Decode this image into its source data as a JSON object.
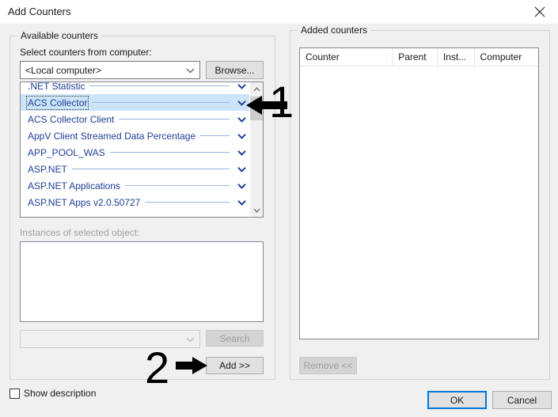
{
  "window": {
    "title": "Add Counters",
    "close_icon": "close-icon"
  },
  "available_group": {
    "legend": "Available counters",
    "computer_label": "Select counters from computer:",
    "computer_value": "<Local computer>",
    "browse_label": "Browse...",
    "counters": [
      {
        "name": ".NET Statistic",
        "expand_icon": "chevron-down-icon",
        "selected": false
      },
      {
        "name": "ACS Collector",
        "expand_icon": "chevron-down-icon",
        "selected": true
      },
      {
        "name": "ACS Collector Client",
        "expand_icon": "chevron-down-icon",
        "selected": false
      },
      {
        "name": "AppV Client Streamed Data Percentage",
        "expand_icon": "chevron-down-icon",
        "selected": false
      },
      {
        "name": "APP_POOL_WAS",
        "expand_icon": "chevron-down-icon",
        "selected": false
      },
      {
        "name": "ASP.NET",
        "expand_icon": "chevron-down-icon",
        "selected": false
      },
      {
        "name": "ASP.NET Applications",
        "expand_icon": "chevron-down-icon",
        "selected": false
      },
      {
        "name": "ASP.NET Apps v2.0.50727",
        "expand_icon": "chevron-down-icon",
        "selected": false
      }
    ],
    "instances_label": "Instances of selected object:",
    "instances": [],
    "search_value": "",
    "search_button_label": "Search",
    "add_button_label": "Add >>"
  },
  "added_group": {
    "legend": "Added counters",
    "columns": [
      "Counter",
      "Parent",
      "Inst...",
      "Computer"
    ],
    "rows": [],
    "remove_button_label": "Remove <<"
  },
  "footer": {
    "show_description_label": "Show description",
    "show_description_checked": false,
    "ok_label": "OK",
    "cancel_label": "Cancel"
  },
  "annotations": [
    {
      "text": "1",
      "arrow": "left-arrow-icon"
    },
    {
      "text": "2",
      "arrow": "right-arrow-icon"
    }
  ],
  "colors": {
    "dialog_bg": "#f0f0f0",
    "titlebar_bg": "#ffffff",
    "counter_text": "#1f3f99",
    "selection_bg": "#cce4f7",
    "focus_blue": "#0078d7",
    "disabled_text": "#9d9d9d"
  }
}
